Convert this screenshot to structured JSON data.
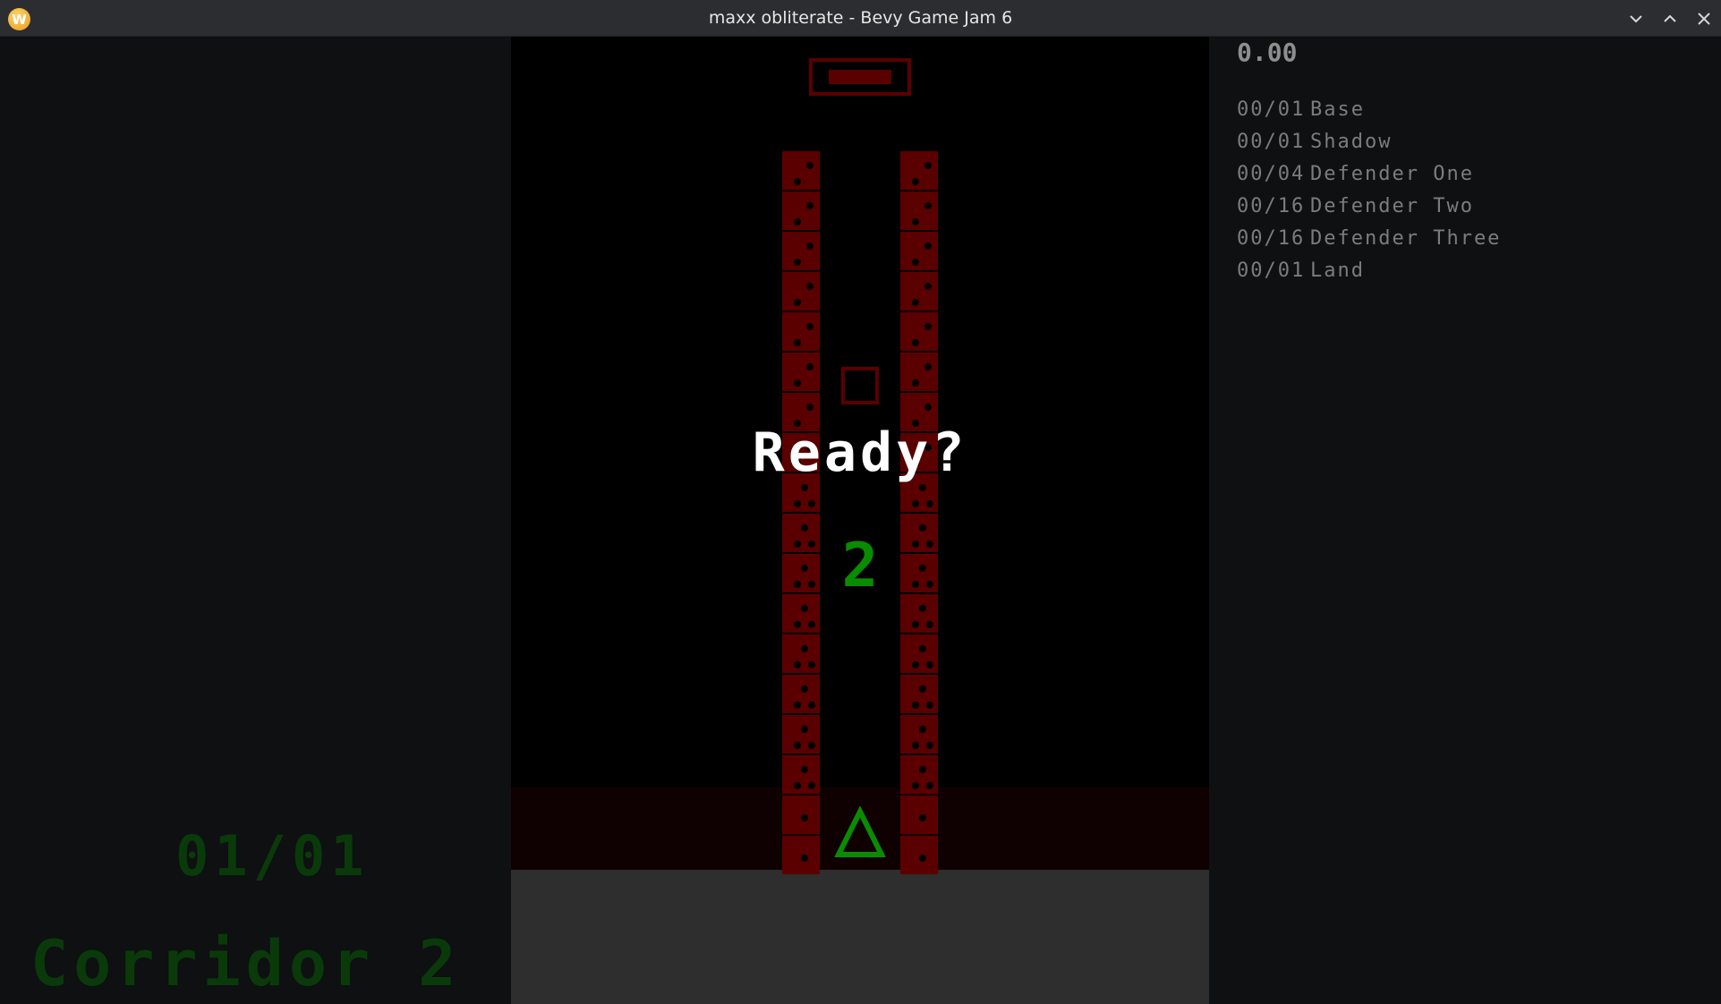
{
  "window": {
    "title": "maxx obliterate - Bevy Game Jam 6",
    "app_icon": "W",
    "controls": [
      "minimize-icon",
      "maximize-icon",
      "close-icon"
    ]
  },
  "game": {
    "ready_text": "Ready?",
    "countdown": "2",
    "counter": "01/01",
    "level_name": "Corridor 2",
    "colors": {
      "block": "#5a0000",
      "accent_green": "#0a8c00",
      "dim_green": "#0a3a0a",
      "panel_bg": "#0e1012"
    }
  },
  "hud": {
    "timer": "0.00",
    "stats": [
      {
        "count": "00/01",
        "label": "Base"
      },
      {
        "count": "00/01",
        "label": "Shadow"
      },
      {
        "count": "00/04",
        "label": "Defender One"
      },
      {
        "count": "00/16",
        "label": "Defender Two"
      },
      {
        "count": "00/16",
        "label": "Defender Three"
      },
      {
        "count": "00/01",
        "label": "Land"
      }
    ]
  }
}
